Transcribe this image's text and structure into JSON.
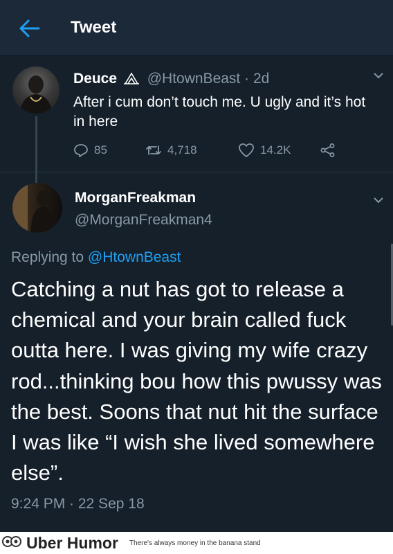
{
  "header": {
    "title": "Tweet"
  },
  "tweet1": {
    "author_name": "Deuce",
    "handle": "@HtownBeast",
    "separator": "·",
    "age": "2d",
    "text": "After i cum don’t touch me. U ugly and it’s hot in here",
    "replies": "85",
    "retweets": "4,718",
    "likes": "14.2K"
  },
  "tweet2": {
    "author_name": "MorganFreakman",
    "handle": "@MorganFreakman4",
    "replying_to_label": "Replying to",
    "replying_to_handle": "@HtownBeast",
    "text": "Catching a nut has got to release a chemical and your brain called fuck outta here. I was giving my wife crazy rod...thinking bou how this pwussy was the best. Soons that nut hit the surface I was like “I wish she lived somewhere else”.",
    "timestamp": "9:24 PM · 22 Sep 18"
  },
  "watermark": {
    "brand": "Uber Humor",
    "tagline": "There's always money in the banana stand"
  },
  "colors": {
    "background": "#15202b",
    "header": "#1c2938",
    "accent": "#1da1f2",
    "muted": "#8899a6"
  },
  "icons": [
    "back-arrow-icon",
    "owl-icon",
    "chevron-down-icon",
    "reply-icon",
    "retweet-icon",
    "like-icon",
    "share-icon",
    "owl-logo-icon"
  ]
}
